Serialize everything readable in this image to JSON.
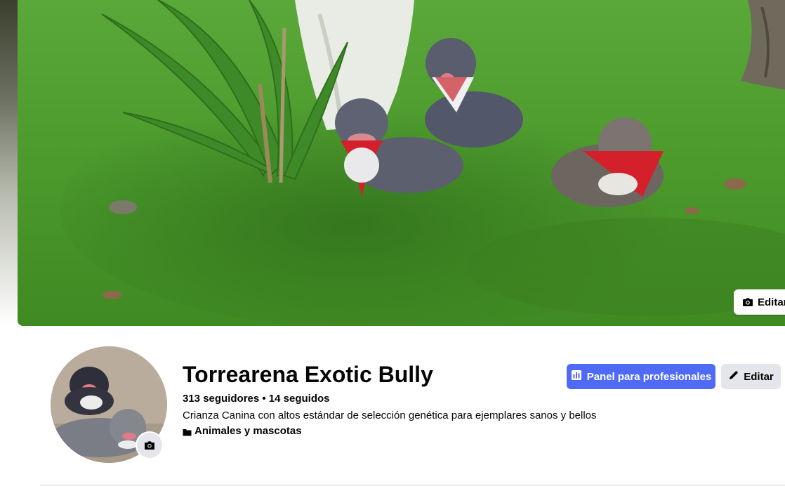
{
  "cover": {
    "edit_label": "Editar",
    "image_description_icon": "camera-icon"
  },
  "profile": {
    "name": "Torrearena Exotic Bully",
    "followers": "313 seguidores • 14 seguidos",
    "bio": "Crianza Canina con altos estándar de selección genética para ejemplares sanos y bellos",
    "category": "Animales y mascotas",
    "category_icon": "category-icon"
  },
  "actions": {
    "professional_dashboard_label": "Panel para profesionales",
    "professional_dashboard_icon": "dashboard-icon",
    "edit_label": "Editar",
    "edit_icon": "pencil-icon"
  },
  "colors": {
    "primary_button": "#4f6bf5",
    "secondary_button": "#e4e6eb",
    "text": "#050505",
    "grass": "#4e9a2a"
  }
}
